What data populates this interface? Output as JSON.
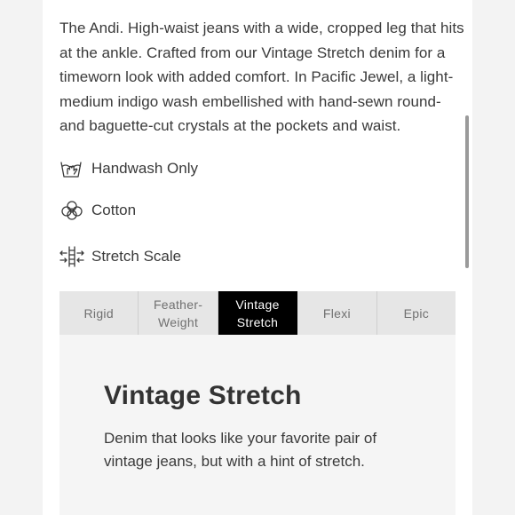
{
  "product": {
    "description": "The Andi. High-waist jeans with a wide, cropped leg that hits at the ankle. Crafted from our Vintage Stretch denim for a timeworn look with added comfort. In Pacific Jewel, a light-medium indigo wash embellished with hand-sewn round- and baguette-cut crystals at the pockets and waist."
  },
  "features": [
    {
      "label": "Handwash Only",
      "icon": "handwash-icon"
    },
    {
      "label": "Cotton",
      "icon": "cotton-icon"
    },
    {
      "label": "Stretch Scale",
      "icon": "stretch-scale-icon"
    }
  ],
  "stretch_tabs": {
    "items": [
      "Rigid",
      "Feather-\nWeight",
      "Vintage\nStretch",
      "Flexi",
      "Epic"
    ],
    "active_index": 2
  },
  "stretch_detail": {
    "title": "Vintage Stretch",
    "body": "Denim that looks like your favorite pair of vintage jeans, but with a hint of stretch."
  },
  "colors": {
    "active_tab_bg": "#000000",
    "tab_bg": "#e6e6e6",
    "detail_bg": "#f5f5f5"
  }
}
